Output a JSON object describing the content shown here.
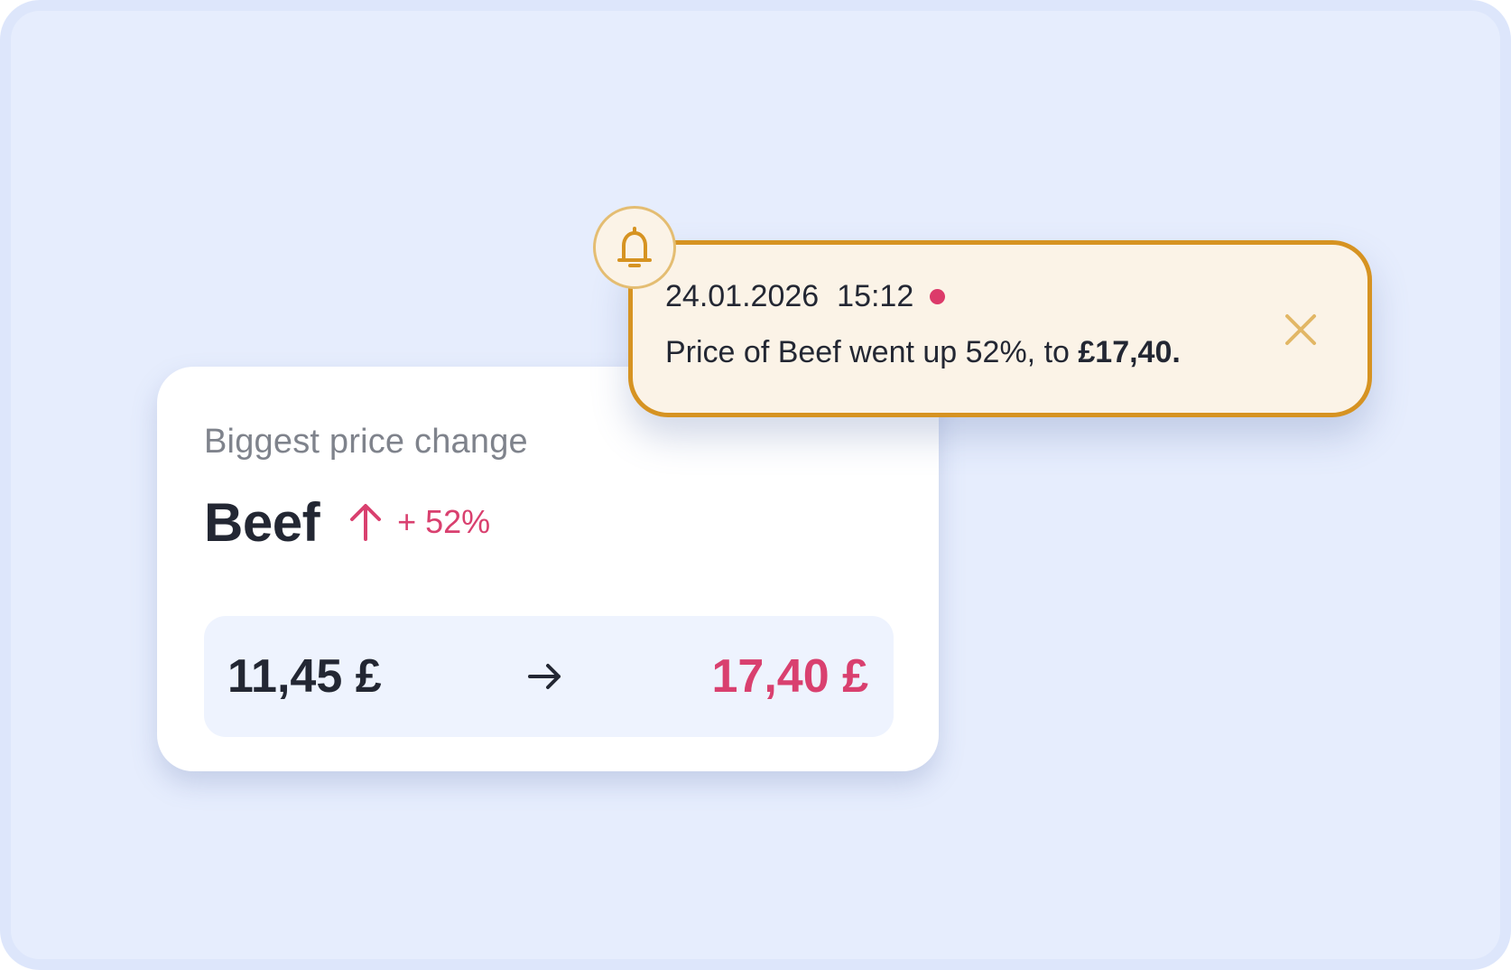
{
  "card": {
    "title": "Biggest price change",
    "product_name": "Beef",
    "change_direction_icon": "arrow-up-icon",
    "change_percent": "+ 52%",
    "old_price": "11,45 £",
    "arrow_icon": "arrow-right-icon",
    "new_price": "17,40 £"
  },
  "notification": {
    "icon": "bell-icon",
    "date": "24.01.2026",
    "time": "15:12",
    "unread": true,
    "message_prefix": "Price of Beef went up 52%, to ",
    "message_amount": "£17,40.",
    "close_icon": "close-icon"
  },
  "colors": {
    "background": "#e6edfd",
    "accent_pink": "#d9406f",
    "accent_gold": "#d69322",
    "toast_background": "#fbf3e7",
    "text_dark": "#232733",
    "text_muted": "#7f838c",
    "price_box_background": "#eef3fe"
  }
}
